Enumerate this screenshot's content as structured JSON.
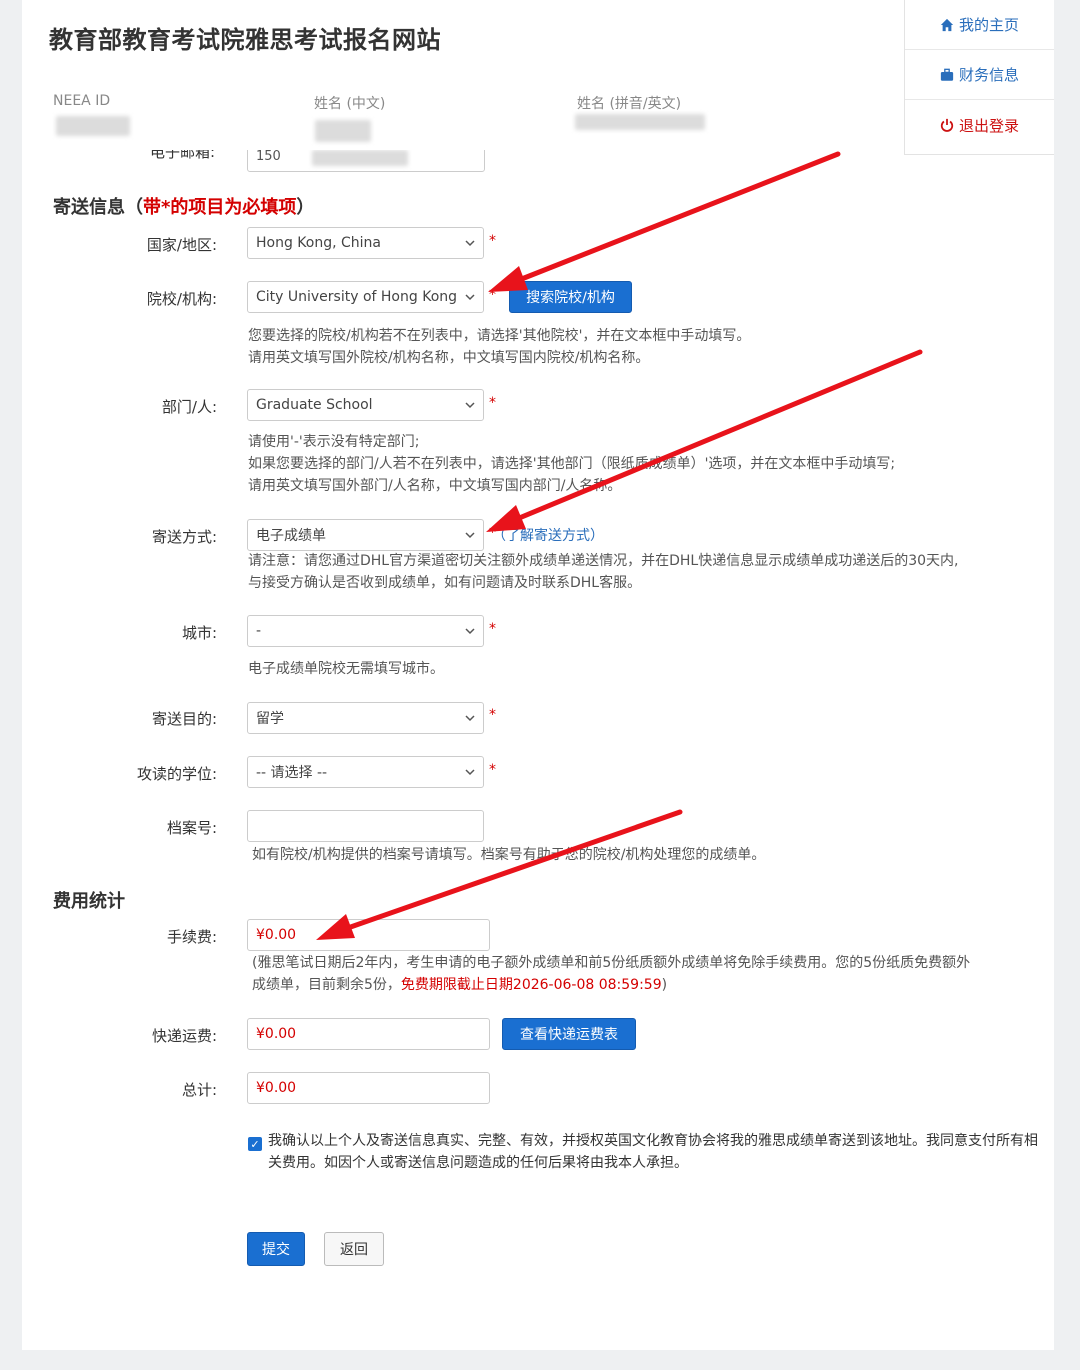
{
  "header": {
    "site_title": "教育部教育考试院雅思考试报名网站",
    "neea_id_label": "NEEA ID",
    "name_cn_label": "姓名 (中文)",
    "name_en_label": "姓名 (拼音/英文)"
  },
  "side_nav": {
    "home": "我的主页",
    "finance": "财务信息",
    "logout": "退出登录"
  },
  "cut_row": {
    "label": "电子邮箱:",
    "value": "150"
  },
  "mailing": {
    "title": "寄送信息",
    "title_paren_open": "（",
    "title_required": "带*的项目为必填项",
    "title_paren_close": "）",
    "star": "*",
    "country_label": "国家/地区:",
    "country_value": "Hong Kong, China",
    "institution_label": "院校/机构:",
    "institution_value": "City University of Hong Kong",
    "search_institution_button": "搜索院校/机构",
    "institution_help_1": "您要选择的院校/机构若不在列表中，请选择'其他院校'，并在文本框中手动填写。",
    "institution_help_2": "请用英文填写国外院校/机构名称，中文填写国内院校/机构名称。",
    "department_label": "部门/人:",
    "department_value": "Graduate School",
    "department_help_1": "请使用'-'表示没有特定部门;",
    "department_help_2": "如果您要选择的部门/人若不在列表中，请选择'其他部门（限纸质成绩单）'选项，并在文本框中手动填写;",
    "department_help_3": "请用英文填写国外部门/人名称，中文填写国内部门/人名称。",
    "method_label": "寄送方式:",
    "method_value": "电子成绩单",
    "method_link": "（了解寄送方式）",
    "method_help_1": "请注意：请您通过DHL官方渠道密切关注额外成绩单递送情况，并在DHL快递信息显示成绩单成功递送后的30天内,",
    "method_help_2": "与接受方确认是否收到成绩单，如有问题请及时联系DHL客服。",
    "city_label": "城市:",
    "city_value": "-",
    "city_help": "电子成绩单院校无需填写城市。",
    "purpose_label": "寄送目的:",
    "purpose_value": "留学",
    "degree_label": "攻读的学位:",
    "degree_value": "-- 请选择 --",
    "file_label": "档案号:",
    "file_value": "",
    "file_help": "如有院校/机构提供的档案号请填写。档案号有助于您的院校/机构处理您的成绩单。"
  },
  "fees": {
    "title": "费用统计",
    "handling_label": "手续费:",
    "handling_value": "¥0.00",
    "handling_help_1": "(雅思笔试日期后2年内，考生申请的电子额外成绩单和前5份纸质额外成绩单将免除手续费用。您的5份纸质免费额外",
    "handling_help_2": "成绩单，目前剩余5份，",
    "handling_help_red": "免费期限截止日期2026-06-08 08:59:59",
    "handling_help_close": ")",
    "shipping_label": "快递运费:",
    "shipping_value": "¥0.00",
    "shipping_button": "查看快递运费表",
    "total_label": "总计:",
    "total_value": "¥0.00"
  },
  "confirm": {
    "checked": true,
    "text": "我确认以上个人及寄送信息真实、完整、有效，并授权英国文化教育协会将我的雅思成绩单寄送到该地址。我同意支付所有相关费用。如因个人或寄送信息问题造成的任何后果将由我本人承担。"
  },
  "actions": {
    "submit": "提交",
    "back": "返回"
  },
  "colors": {
    "accent": "#1a6fd1",
    "required": "#d40000",
    "annotation_arrow": "#e8131b"
  }
}
